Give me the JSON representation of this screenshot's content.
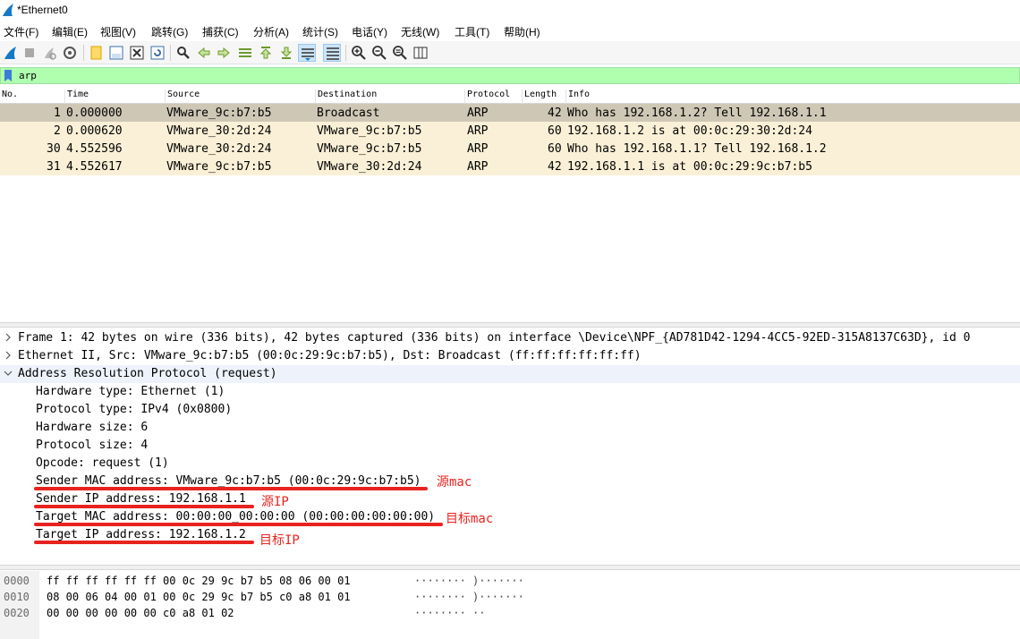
{
  "window": {
    "title": "*Ethernet0",
    "icon": "wireshark-fin-icon"
  },
  "menu": [
    {
      "label": "文件(F)"
    },
    {
      "label": "编辑(E)"
    },
    {
      "label": "视图(V)"
    },
    {
      "label": "跳转(G)"
    },
    {
      "label": "捕获(C)"
    },
    {
      "label": "分析(A)"
    },
    {
      "label": "统计(S)"
    },
    {
      "label": "电话(Y)"
    },
    {
      "label": "无线(W)"
    },
    {
      "label": "工具(T)"
    },
    {
      "label": "帮助(H)"
    }
  ],
  "toolbar": {
    "buttons": [
      "start-capture-icon",
      "stop-capture-icon",
      "restart-capture-icon",
      "capture-options-icon",
      "open-file-icon",
      "save-file-icon",
      "close-file-icon",
      "reload-file-icon",
      "find-packet-icon",
      "go-back-icon",
      "go-forward-icon",
      "go-to-packet-icon",
      "first-packet-icon",
      "last-packet-icon",
      "auto-scroll-icon",
      "colorize-icon",
      "zoom-in-icon",
      "zoom-out-icon",
      "zoom-normal-icon",
      "resize-columns-icon"
    ]
  },
  "filter": {
    "value": "arp",
    "bg_color": "#afffaf"
  },
  "packet_list": {
    "columns": [
      "No.",
      "Time",
      "Source",
      "Destination",
      "Protocol",
      "Length",
      "Info"
    ],
    "rows": [
      {
        "no": "1",
        "time": "0.000000",
        "source": "VMware_9c:b7:b5",
        "destination": "Broadcast",
        "protocol": "ARP",
        "length": "42",
        "info": "Who has 192.168.1.2? Tell 192.168.1.1"
      },
      {
        "no": "2",
        "time": "0.000620",
        "source": "VMware_30:2d:24",
        "destination": "VMware_9c:b7:b5",
        "protocol": "ARP",
        "length": "60",
        "info": "192.168.1.2 is at 00:0c:29:30:2d:24"
      },
      {
        "no": "30",
        "time": "4.552596",
        "source": "VMware_30:2d:24",
        "destination": "VMware_9c:b7:b5",
        "protocol": "ARP",
        "length": "60",
        "info": "Who has 192.168.1.1? Tell 192.168.1.2"
      },
      {
        "no": "31",
        "time": "4.552617",
        "source": "VMware_9c:b7:b5",
        "destination": "VMware_30:2d:24",
        "protocol": "ARP",
        "length": "42",
        "info": "192.168.1.1 is at 00:0c:29:9c:b7:b5"
      }
    ],
    "row_color": "#faf0d7",
    "selected_row_color": "#cfc7b5"
  },
  "details": {
    "frame": "Frame 1: 42 bytes on wire (336 bits), 42 bytes captured (336 bits) on interface \\Device\\NPF_{AD781D42-1294-4CC5-92ED-315A8137C63D}, id 0",
    "ethernet": "Ethernet II, Src: VMware_9c:b7:b5 (00:0c:29:9c:b7:b5), Dst: Broadcast (ff:ff:ff:ff:ff:ff)",
    "arp": "Address Resolution Protocol (request)",
    "fields": [
      "Hardware type: Ethernet (1)",
      "Protocol type: IPv4 (0x0800)",
      "Hardware size: 6",
      "Protocol size: 4",
      "Opcode: request (1)",
      "Sender MAC address: VMware_9c:b7:b5 (00:0c:29:9c:b7:b5)",
      "Sender IP address: 192.168.1.1",
      "Target MAC address: 00:00:00_00:00:00 (00:00:00:00:00:00)",
      "Target IP address: 192.168.1.2"
    ],
    "annotations": {
      "sender_mac": "源mac",
      "sender_ip": "源IP",
      "target_mac": "目标mac",
      "target_ip": "目标IP"
    },
    "annotation_color": "#e8231f"
  },
  "bytes": [
    {
      "offset": "0000",
      "hex": "ff ff ff ff ff ff 00 0c  29 9c b7 b5 08 06 00 01",
      "ascii": "········ )·······"
    },
    {
      "offset": "0010",
      "hex": "08 00 06 04 00 01 00 0c  29 9c b7 b5 c0 a8 01 01",
      "ascii": "········ )·······"
    },
    {
      "offset": "0020",
      "hex": "00 00 00 00 00 00 c0 a8  01 02",
      "ascii": "········ ··"
    }
  ]
}
